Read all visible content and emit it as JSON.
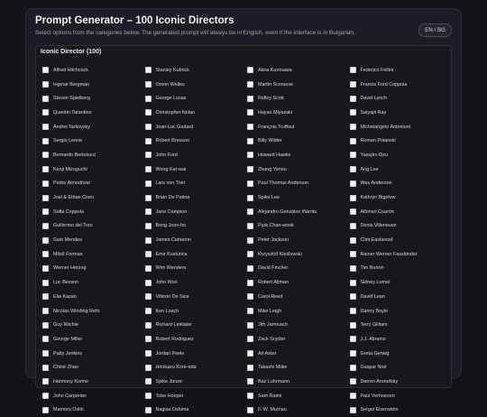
{
  "header": {
    "title": "Prompt Generator – 100 Iconic Directors",
    "subtitle": "Select options from the categories below. The generated prompt will always be in English, even if the interface is in Bulgarian.",
    "lang_toggle": "EN / BG"
  },
  "category": {
    "title": "Iconic Director (100)",
    "items": [
      "Alfred Hitchcock",
      "Stanley Kubrick",
      "Akira Kurosawa",
      "Federico Fellini",
      "Ingmar Bergman",
      "Orson Welles",
      "Martin Scorsese",
      "Francis Ford Coppola",
      "Steven Spielberg",
      "George Lucas",
      "Ridley Scott",
      "David Lynch",
      "Quentin Tarantino",
      "Christopher Nolan",
      "Hayao Miyazaki",
      "Satyajit Ray",
      "Andrei Tarkovsky",
      "Jean-Luc Godard",
      "François Truffaut",
      "Michelangelo Antonioni",
      "Sergio Leone",
      "Robert Bresson",
      "Billy Wilder",
      "Roman Polanski",
      "Bernardo Bertolucci",
      "John Ford",
      "Howard Hawks",
      "Yasujiro Ozu",
      "Kenji Mizoguchi",
      "Wong Kar-wai",
      "Zhang Yimou",
      "Ang Lee",
      "Pedro Almodóvar",
      "Lars von Trier",
      "Paul Thomas Anderson",
      "Wes Anderson",
      "Joel & Ethan Coen",
      "Brian De Palma",
      "Spike Lee",
      "Kathryn Bigelow",
      "Sofia Coppola",
      "Jane Campion",
      "Alejandro González Iñárritu",
      "Alfonso Cuarón",
      "Guillermo del Toro",
      "Bong Joon-ho",
      "Park Chan-wook",
      "Denis Villeneuve",
      "Sam Mendes",
      "James Cameron",
      "Peter Jackson",
      "Clint Eastwood",
      "Miloš Forman",
      "Emir Kusturica",
      "Krzysztof Kieślowski",
      "Rainer Werner Fassbinder",
      "Werner Herzog",
      "Wim Wenders",
      "David Fincher",
      "Tim Burton",
      "Luc Besson",
      "John Woo",
      "Robert Altman",
      "Sidney Lumet",
      "Elia Kazan",
      "Vittorio De Sica",
      "Carol Reed",
      "David Lean",
      "Nicolas Winding Refn",
      "Ken Loach",
      "Mike Leigh",
      "Danny Boyle",
      "Guy Ritchie",
      "Richard Linklater",
      "Jim Jarmusch",
      "Terry Gilliam",
      "George Miller",
      "Robert Rodriguez",
      "Zack Snyder",
      "J.J. Abrams",
      "Patty Jenkins",
      "Jordan Peele",
      "Ari Aster",
      "Greta Gerwig",
      "Chloé Zhao",
      "Hirokazu Kore-eda",
      "Takashi Miike",
      "Gaspar Noé",
      "Harmony Korine",
      "Spike Jonze",
      "Baz Luhrmann",
      "Darren Aronofsky",
      "John Carpenter",
      "Tobe Hooper",
      "Sam Raimi",
      "Paul Verhoeven",
      "Mamoru Oshii",
      "Nagisa Oshima",
      "F. W. Murnau",
      "Sergei Eisenstein"
    ]
  }
}
